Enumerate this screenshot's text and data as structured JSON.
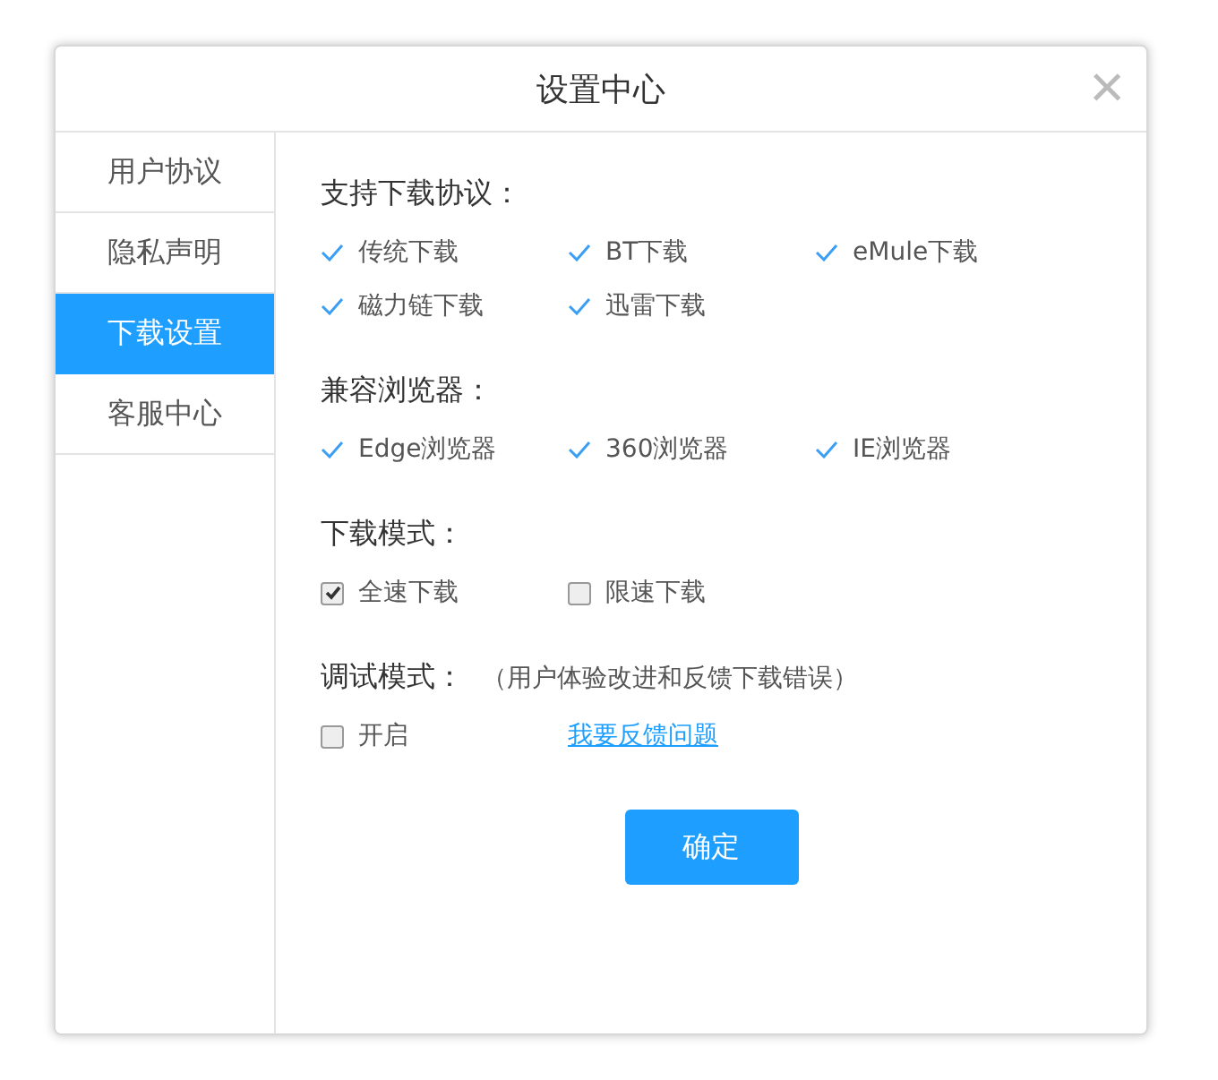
{
  "dialog": {
    "title": "设置中心",
    "close": "×"
  },
  "sidebar": {
    "items": [
      {
        "label": "用户协议",
        "selected": false
      },
      {
        "label": "隐私声明",
        "selected": false
      },
      {
        "label": "下载设置",
        "selected": true
      },
      {
        "label": "客服中心",
        "selected": false
      }
    ]
  },
  "sections": [
    {
      "kind": "ticks",
      "title": "支持下载协议：",
      "items": [
        {
          "label": "传统下载",
          "checked": true
        },
        {
          "label": "BT下载",
          "checked": true
        },
        {
          "label": "eMule下载",
          "checked": true
        },
        {
          "label": "磁力链下载",
          "checked": true
        },
        {
          "label": "迅雷下载",
          "checked": true
        }
      ]
    },
    {
      "kind": "ticks",
      "title": "兼容浏览器：",
      "items": [
        {
          "label": "Edge浏览器",
          "checked": true
        },
        {
          "label": "360浏览器",
          "checked": true
        },
        {
          "label": "IE浏览器",
          "checked": true
        }
      ]
    },
    {
      "kind": "checkboxes",
      "title": "下载模式：",
      "items": [
        {
          "label": "全速下载",
          "checked": true
        },
        {
          "label": "限速下载",
          "checked": false
        }
      ]
    },
    {
      "kind": "checkboxes",
      "title": "调试模式：",
      "note": "（用户体验改进和反馈下载错误）",
      "items": [
        {
          "label": "开启",
          "checked": false
        }
      ],
      "link": "我要反馈问题"
    }
  ],
  "confirm_button": "确定"
}
